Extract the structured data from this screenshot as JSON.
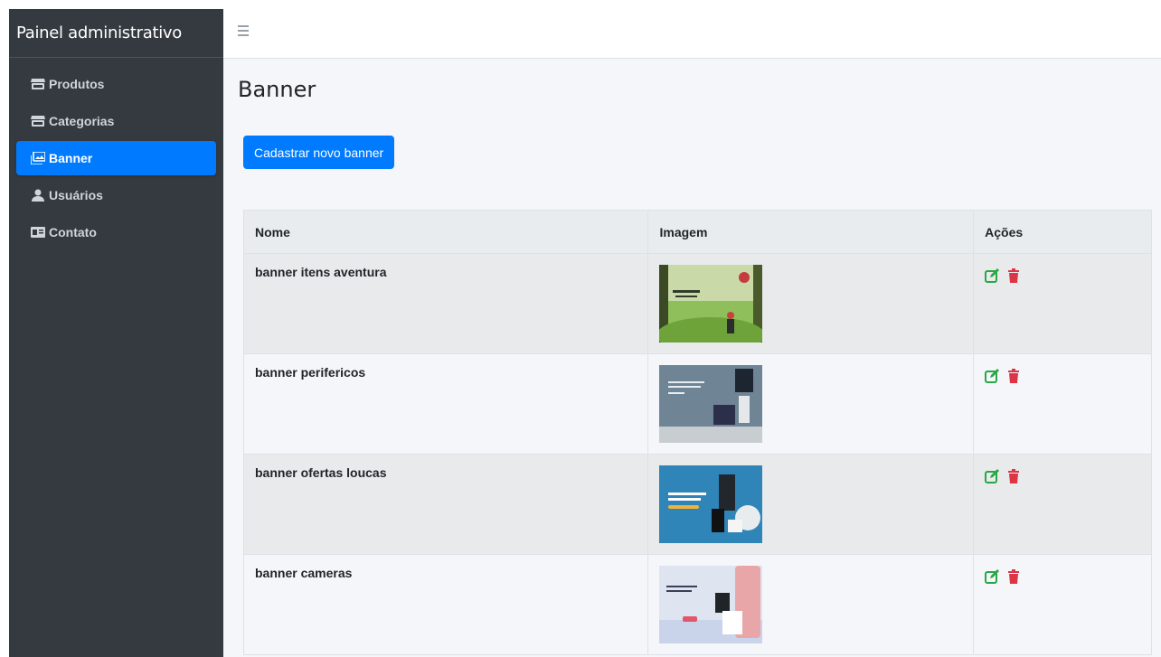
{
  "sidebar": {
    "brand": "Painel administrativo",
    "items": [
      {
        "label": "Produtos",
        "icon": "store-icon",
        "active": false
      },
      {
        "label": "Categorias",
        "icon": "store-icon",
        "active": false
      },
      {
        "label": "Banner",
        "icon": "images-icon",
        "active": true
      },
      {
        "label": "Usuários",
        "icon": "user-icon",
        "active": false
      },
      {
        "label": "Contato",
        "icon": "id-card-icon",
        "active": false
      }
    ]
  },
  "topbar": {
    "menu_icon": "hamburger-icon"
  },
  "main": {
    "title": "Banner",
    "new_button": "Cadastrar novo banner",
    "table": {
      "headers": [
        "Nome",
        "Imagem",
        "Ações"
      ],
      "rows": [
        {
          "name": "banner itens aventura",
          "thumb": "adventure-banner-image"
        },
        {
          "name": "banner perifericos",
          "thumb": "peripherals-banner-image"
        },
        {
          "name": "banner ofertas loucas",
          "thumb": "crazy-offers-banner-image"
        },
        {
          "name": "banner cameras",
          "thumb": "cameras-banner-image"
        }
      ]
    }
  },
  "colors": {
    "sidebar_bg": "#343a40",
    "primary": "#007bff",
    "edit_icon": "#28a745",
    "delete_icon": "#dc3545",
    "content_bg": "#f4f6f9"
  }
}
